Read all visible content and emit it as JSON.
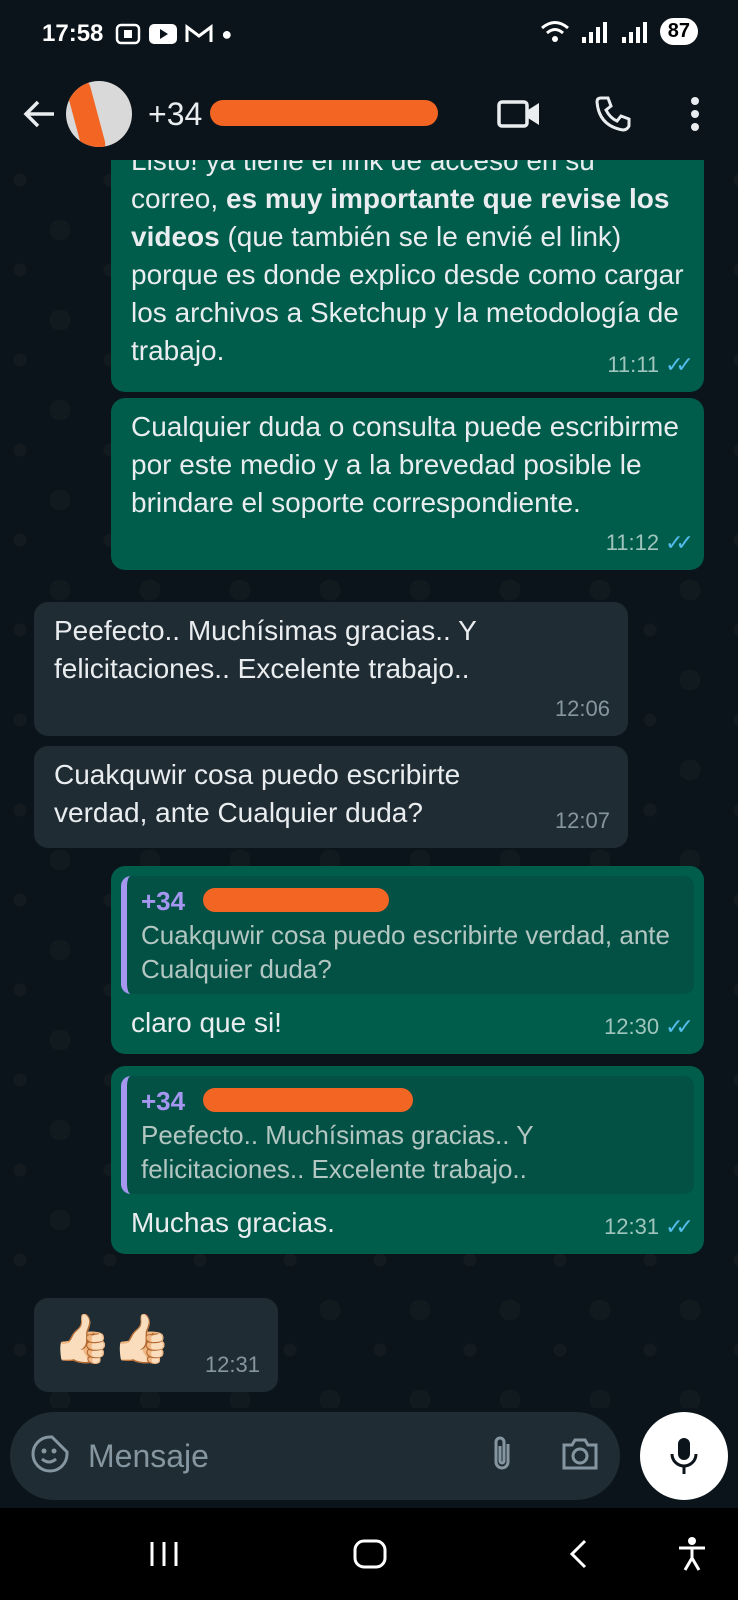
{
  "status_bar": {
    "time": "17:58",
    "battery": "87"
  },
  "header": {
    "contact_prefix": "+34"
  },
  "messages": [
    {
      "direction": "out",
      "text_parts": [
        "Listo! ya tiene el link de acceso en su correo, ",
        "es muy importante que revise los videos",
        " (que también se le envié el link) porque es donde explico desde como cargar los archivos a Sketchup y la metodología de trabajo."
      ],
      "time": "11:11"
    },
    {
      "direction": "out",
      "text": "Cualquier duda o consulta puede escribirme por este medio y a la brevedad posible le brindare el soporte correspondiente.",
      "time": "11:12"
    },
    {
      "direction": "in",
      "text": "Peefecto.. Muchísimas gracias.. Y felicitaciones.. Excelente trabajo..",
      "time": "12:06"
    },
    {
      "direction": "in",
      "text": "Cuakquwir cosa puedo escribirte verdad, ante Cualquier duda?",
      "time": "12:07"
    },
    {
      "direction": "out",
      "quote_author": "+34",
      "quote_text": "Cuakquwir cosa puedo escribirte verdad, ante Cualquier duda?",
      "text": "claro que si!",
      "time": "12:30"
    },
    {
      "direction": "out",
      "quote_author": "+34",
      "quote_text": "Peefecto.. Muchísimas gracias.. Y felicitaciones.. Excelente trabajo..",
      "text": "Muchas gracias.",
      "time": "12:31"
    },
    {
      "direction": "in",
      "text": "👍🏻👍🏻",
      "time": "12:31"
    }
  ],
  "input": {
    "placeholder": "Mensaje"
  }
}
